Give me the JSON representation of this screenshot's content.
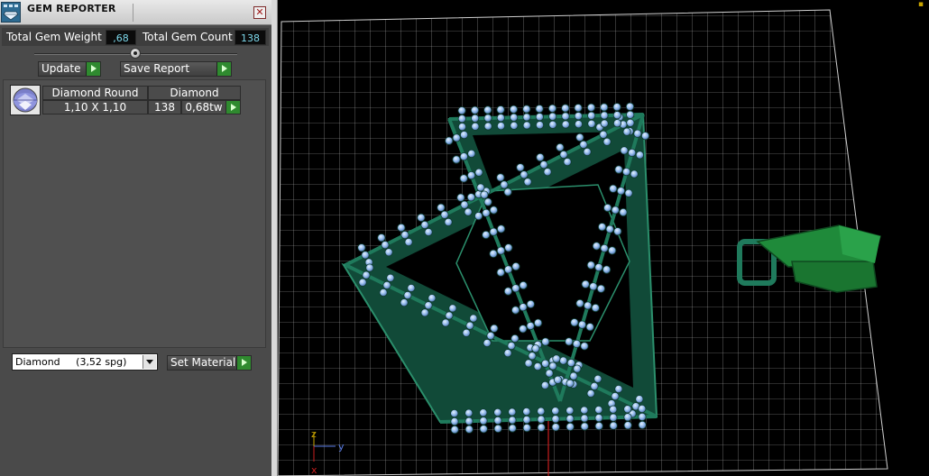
{
  "panel": {
    "title": "GEM REPORTER",
    "close_glyph": "✕",
    "total_weight_label": "Total Gem Weight",
    "total_weight_value": ",68",
    "total_count_label": "Total Gem Count",
    "total_count_value": "138",
    "update_label": "Update",
    "save_report_label": "Save Report",
    "set_material_label": "Set Material",
    "material_selected": "Diamond     (3,52 spg)"
  },
  "gem_table": {
    "headers": [
      "Diamond Round",
      "Diamond"
    ],
    "row": {
      "size": "1,10 X 1,10",
      "count": "138",
      "weight": "0,68tw"
    }
  },
  "viewport": {
    "axis_z": "z",
    "axis_y": "y",
    "axis_x": "x"
  },
  "colors": {
    "panel_bg": "#4a4a4a",
    "readout_text": "#7cd7ea",
    "go_button": "#2f8a2f",
    "model_green": "#1d6f55",
    "gem_blue": "#8eb6ea",
    "grid": "#d0d0d0"
  },
  "icons": [
    "app-icon",
    "close-icon",
    "gem-thumbnail-icon",
    "chevron-down-icon",
    "play-arrow-icon"
  ]
}
